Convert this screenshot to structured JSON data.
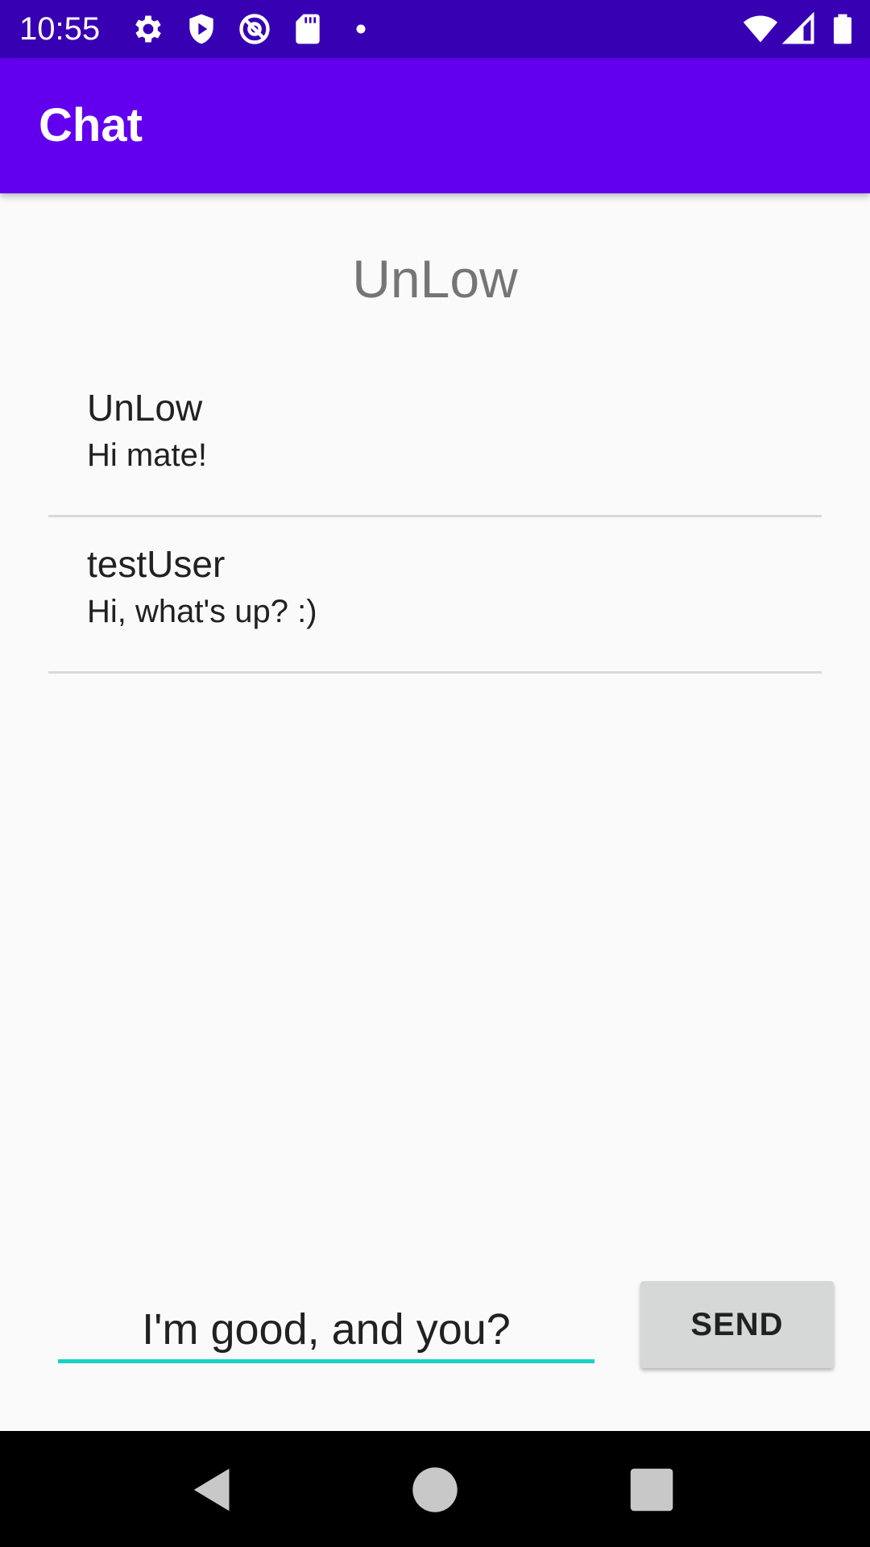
{
  "status_bar": {
    "time": "10:55",
    "left_icons": [
      "settings-icon",
      "shield-play-icon",
      "at-sign-icon",
      "sd-card-icon",
      "dot-icon"
    ],
    "right_icons": [
      "wifi-icon",
      "cell-signal-icon",
      "battery-icon"
    ]
  },
  "app_bar": {
    "title": "Chat",
    "color": "#6200ee",
    "status_color": "#3700b3"
  },
  "chat": {
    "partner_name": "UnLow",
    "messages": [
      {
        "sender": "UnLow",
        "text": "Hi mate!"
      },
      {
        "sender": "testUser",
        "text": "Hi, what's up? :)"
      }
    ]
  },
  "composer": {
    "input_value": "I'm good, and you?",
    "send_label": "SEND",
    "accent_color": "#18d3c3"
  },
  "nav_bar": {
    "buttons": [
      "back-icon",
      "home-icon",
      "recents-icon"
    ]
  }
}
